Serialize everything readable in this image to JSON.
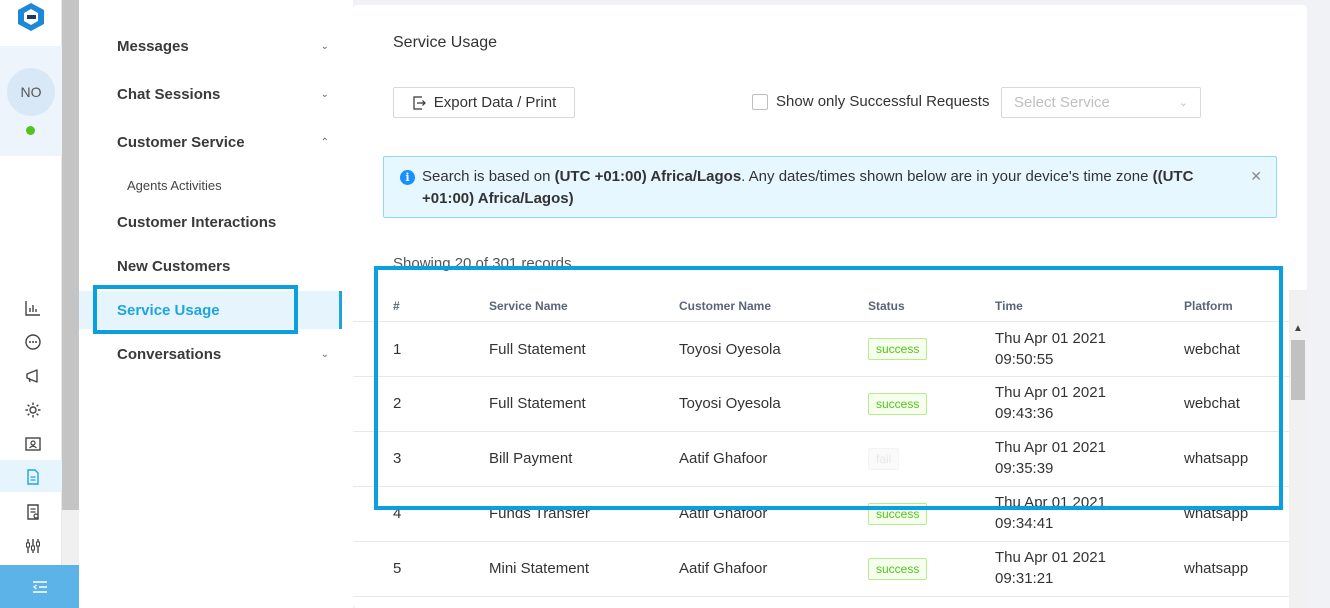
{
  "rail": {
    "avatar_initials": "NO",
    "icons": [
      "chart-icon",
      "chat-icon",
      "megaphone-icon",
      "gear-icon",
      "contact-card-icon",
      "document-icon",
      "report-icon",
      "sliders-icon"
    ]
  },
  "nav": {
    "messages": "Messages",
    "chat_sessions": "Chat Sessions",
    "customer_service": "Customer Service",
    "agents_activities": "Agents Activities",
    "customer_interactions": "Customer Interactions",
    "new_customers": "New Customers",
    "service_usage": "Service Usage",
    "conversations": "Conversations"
  },
  "main": {
    "title": "Service Usage",
    "export_label": "Export Data / Print",
    "checkbox_label": "Show only Successful Requests",
    "select_placeholder": "Select Service",
    "alert": {
      "prefix": "Search is based on ",
      "tz1": "(UTC +01:00) Africa/Lagos",
      "middle": ". Any dates/times shown below are in your device's time zone ",
      "tz2": "((UTC +01:00) Africa/Lagos)"
    },
    "records_text": "Showing 20 of 301 records",
    "columns": [
      "#",
      "Service Name",
      "Customer Name",
      "Status",
      "Time",
      "Platform"
    ],
    "rows": [
      {
        "num": "1",
        "service": "Full Statement",
        "customer": "Toyosi Oyesola",
        "status": "success",
        "time1": "Thu Apr 01 2021",
        "time2": "09:50:55",
        "platform": "webchat"
      },
      {
        "num": "2",
        "service": "Full Statement",
        "customer": "Toyosi Oyesola",
        "status": "success",
        "time1": "Thu Apr 01 2021",
        "time2": "09:43:36",
        "platform": "webchat"
      },
      {
        "num": "3",
        "service": "Bill Payment",
        "customer": "Aatif Ghafoor",
        "status": "fail",
        "time1": "Thu Apr 01 2021",
        "time2": "09:35:39",
        "platform": "whatsapp"
      },
      {
        "num": "4",
        "service": "Funds Transfer",
        "customer": "Aatif Ghafoor",
        "status": "success",
        "time1": "Thu Apr 01 2021",
        "time2": "09:34:41",
        "platform": "whatsapp"
      },
      {
        "num": "5",
        "service": "Mini Statement",
        "customer": "Aatif Ghafoor",
        "status": "success",
        "time1": "Thu Apr 01 2021",
        "time2": "09:31:21",
        "platform": "whatsapp"
      }
    ]
  },
  "colors": {
    "accent": "#1ea5e0",
    "highlight_border": "#0aa0e0",
    "success": "#52c41a",
    "alert_bg": "#e6f7ff"
  }
}
